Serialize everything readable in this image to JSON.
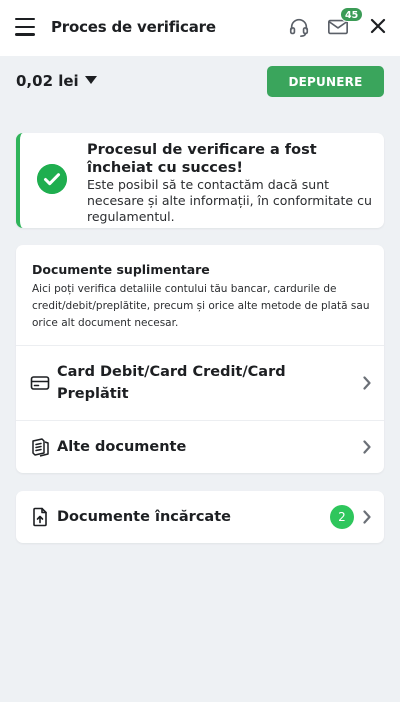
{
  "header": {
    "title": "Proces de verificare",
    "mail_badge": "45",
    "icons": [
      "menu-icon",
      "headset-icon",
      "mail-icon",
      "close-icon"
    ]
  },
  "balance": {
    "amount": "0,02 lei"
  },
  "deposit_button": {
    "label": "DEPUNERE"
  },
  "success": {
    "title": "Procesul de verificare a fost încheiat cu succes!",
    "text": "Este posibil să te contactăm dacă sunt necesare și alte informații, în conformitate cu regulamentul."
  },
  "documents": {
    "title": "Documente suplimentare",
    "description": "Aici poți verifica detaliile contului tău bancar, cardurile de credit/debit/preplătite, precum și orice alte metode de plată sau orice alt document necesar.",
    "items": [
      {
        "label": "Card Debit/Card Credit/Card Preplătit",
        "icon": "card-icon"
      },
      {
        "label": "Alte documente",
        "icon": "documents-icon"
      }
    ]
  },
  "uploaded": {
    "label": "Documente încărcate",
    "count": "2",
    "icon": "upload-file-icon"
  },
  "colors": {
    "accent": "#3aa55c",
    "success": "#1fae4f",
    "background": "#eef1f4"
  }
}
